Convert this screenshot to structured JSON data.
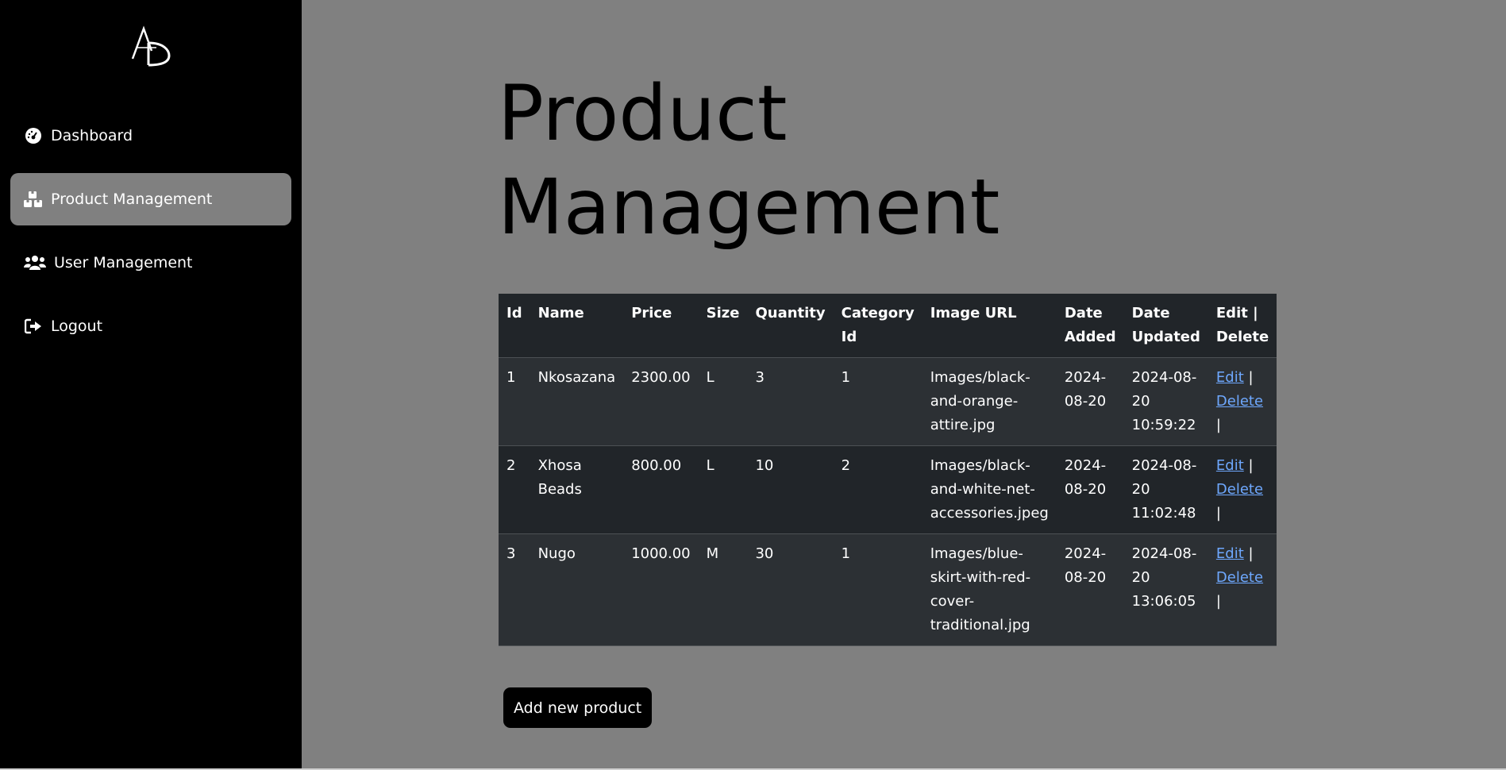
{
  "sidebar": {
    "logo_text": "AD",
    "items": [
      {
        "label": "Dashboard",
        "icon": "gauge-icon",
        "active": false
      },
      {
        "label": "Product Management",
        "icon": "boxes-icon",
        "active": true
      },
      {
        "label": "User Management",
        "icon": "users-icon",
        "active": false
      },
      {
        "label": "Logout",
        "icon": "logout-icon",
        "active": false
      }
    ]
  },
  "main": {
    "title_line1": "Product",
    "title_line2": "Management",
    "table": {
      "headers": [
        "Id",
        "Name",
        "Price",
        "Size",
        "Quantity",
        "Category Id",
        "Image URL",
        "Date Added",
        "Date Updated",
        "Edit | Delete"
      ],
      "rows": [
        {
          "id": "1",
          "name": "Nkosazana",
          "price": "2300.00",
          "size": "L",
          "quantity": "3",
          "category_id": "1",
          "image_url": "Images/black-and-orange-attire.jpg",
          "date_added": "2024-08-20",
          "date_updated": "2024-08-20 10:59:22",
          "edit": "Edit",
          "delete": "Delete",
          "separator": "|"
        },
        {
          "id": "2",
          "name": "Xhosa Beads",
          "price": "800.00",
          "size": "L",
          "quantity": "10",
          "category_id": "2",
          "image_url": "Images/black-and-white-net-accessories.jpeg",
          "date_added": "2024-08-20",
          "date_updated": "2024-08-20 11:02:48",
          "edit": "Edit",
          "delete": "Delete",
          "separator": "|"
        },
        {
          "id": "3",
          "name": "Nugo",
          "price": "1000.00",
          "size": "M",
          "quantity": "30",
          "category_id": "1",
          "image_url": "Images/blue-skirt-with-red-cover-traditional.jpg",
          "date_added": "2024-08-20",
          "date_updated": "2024-08-20 13:06:05",
          "edit": "Edit",
          "delete": "Delete",
          "separator": "|"
        }
      ]
    },
    "add_button_label": "Add new product"
  },
  "colors": {
    "sidebar_bg": "#000000",
    "page_bg": "#808080",
    "active_item_bg": "#808080",
    "table_bg": "#212529",
    "link": "#6ea8fe"
  }
}
